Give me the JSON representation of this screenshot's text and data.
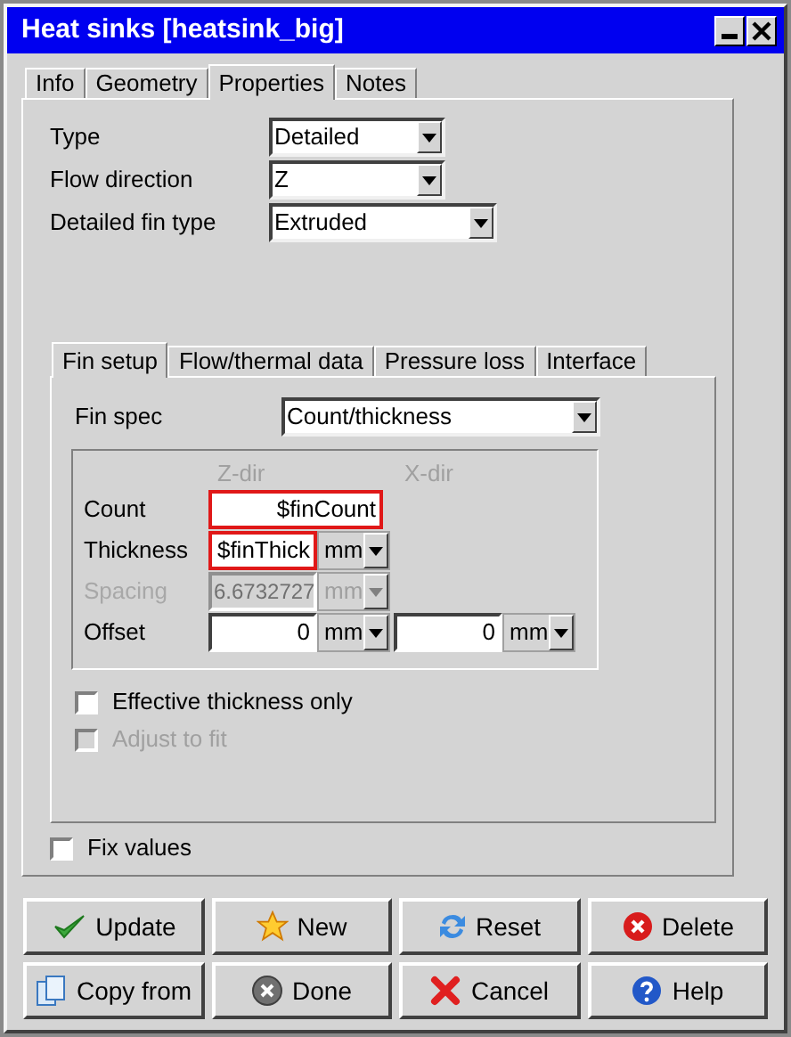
{
  "window": {
    "title": "Heat sinks [heatsink_big]"
  },
  "tabs": [
    {
      "label": "Info",
      "selected": false
    },
    {
      "label": "Geometry",
      "selected": false
    },
    {
      "label": "Properties",
      "selected": true
    },
    {
      "label": "Notes",
      "selected": false
    }
  ],
  "properties": [
    {
      "label": "Type",
      "value": "Detailed"
    },
    {
      "label": "Flow direction",
      "value": "Z"
    },
    {
      "label": "Detailed fin type",
      "value": "Extruded"
    }
  ],
  "fin_tabs": [
    {
      "label": "Fin setup",
      "selected": true
    },
    {
      "label": "Flow/thermal data",
      "selected": false
    },
    {
      "label": "Pressure loss",
      "selected": false
    },
    {
      "label": "Interface",
      "selected": false
    }
  ],
  "fin_spec": {
    "label": "Fin spec",
    "value": "Count/thickness"
  },
  "fin_grid": {
    "columns": [
      "Z-dir",
      "X-dir"
    ],
    "rows": [
      {
        "label": "Count",
        "disabled": false,
        "z": {
          "value": "$finCount",
          "highlighted": true
        }
      },
      {
        "label": "Thickness",
        "disabled": false,
        "z": {
          "value": "$finThick",
          "unit": "mm",
          "highlighted": true
        }
      },
      {
        "label": "Spacing",
        "disabled": true,
        "z": {
          "value": "6.6732727",
          "unit": "mm",
          "highlighted": false
        }
      },
      {
        "label": "Offset",
        "disabled": false,
        "z": {
          "value": "0",
          "unit": "mm",
          "highlighted": false
        },
        "x": {
          "value": "0",
          "unit": "mm",
          "highlighted": false
        }
      }
    ]
  },
  "options": [
    {
      "label": "Effective thickness only",
      "checked": false,
      "disabled": false
    },
    {
      "label": "Adjust to fit",
      "checked": false,
      "disabled": true
    }
  ],
  "fix_values": {
    "label": "Fix values",
    "checked": false
  },
  "buttons": [
    {
      "label": "Update",
      "kind": "update"
    },
    {
      "label": "New",
      "kind": "new"
    },
    {
      "label": "Reset",
      "kind": "reset"
    },
    {
      "label": "Delete",
      "kind": "delete"
    },
    {
      "label": "Copy from",
      "kind": "copy"
    },
    {
      "label": "Done",
      "kind": "done"
    },
    {
      "label": "Cancel",
      "kind": "cancel"
    },
    {
      "label": "Help",
      "kind": "help"
    }
  ]
}
